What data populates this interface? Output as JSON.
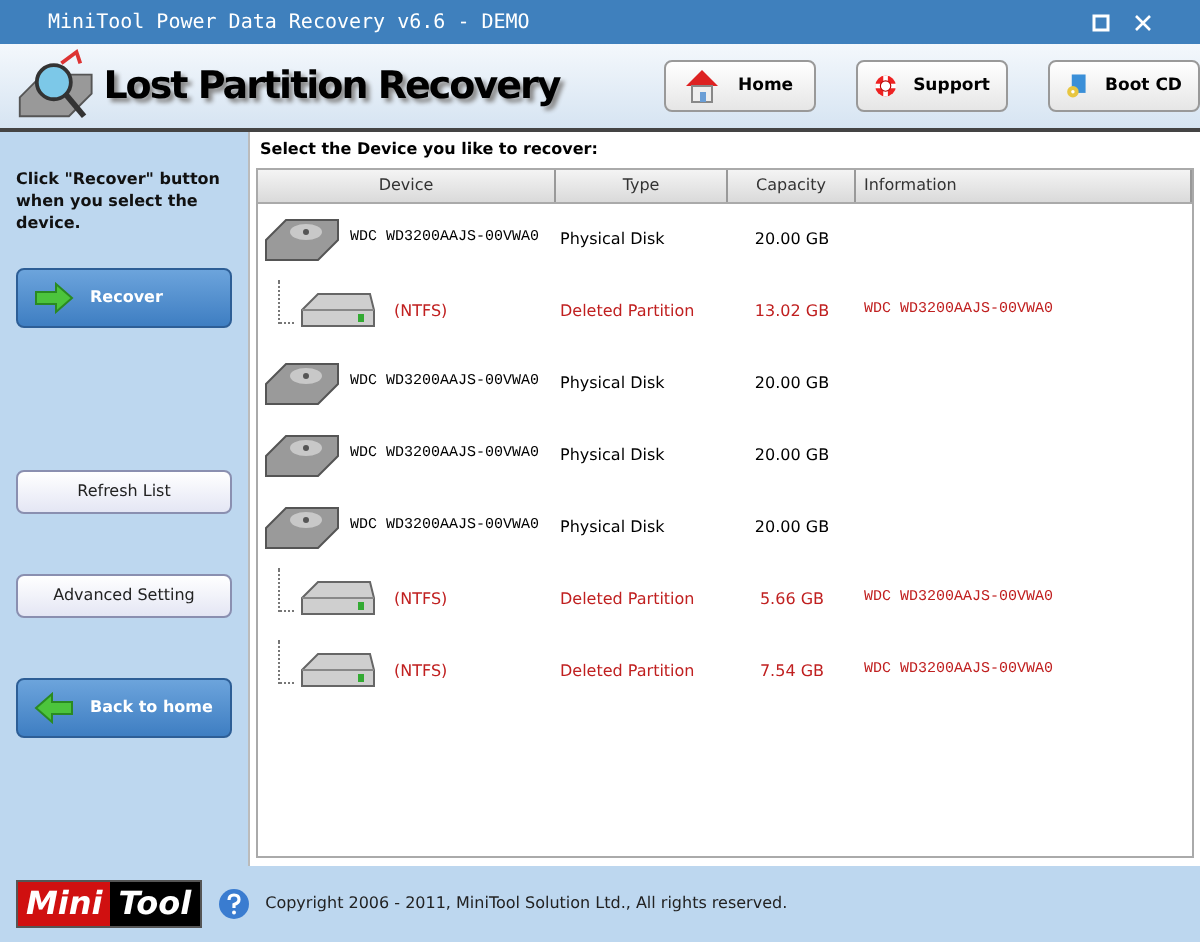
{
  "window": {
    "title": "MiniTool Power Data Recovery v6.6 - DEMO"
  },
  "header": {
    "title": "Lost Partition Recovery",
    "nav": [
      {
        "label": "Home",
        "kind": "home"
      },
      {
        "label": "Support",
        "kind": "support"
      },
      {
        "label": "Boot CD",
        "kind": "bootcd"
      }
    ]
  },
  "sidebar": {
    "hint": "Click \"Recover\" button when you select the device.",
    "buttons": [
      {
        "label": "Recover",
        "kind": "forward"
      },
      {
        "label": "Refresh List",
        "kind": "plain"
      },
      {
        "label": "Advanced Setting",
        "kind": "plain"
      },
      {
        "label": "Back to home",
        "kind": "back"
      }
    ]
  },
  "prompt": "Select the Device you like to recover:",
  "table": {
    "columns": [
      "Device",
      "Type",
      "Capacity",
      "Information"
    ],
    "rows": [
      {
        "kind": "disk",
        "device": "WDC WD3200AAJS-00VWA0",
        "type": "Physical Disk",
        "capacity": "20.00 GB"
      },
      {
        "kind": "partition",
        "device": "(NTFS)",
        "type": "Deleted Partition",
        "capacity": "13.02 GB",
        "information": "WDC WD3200AAJS-00VWA0"
      },
      {
        "kind": "disk",
        "device": "WDC WD3200AAJS-00VWA0",
        "type": "Physical Disk",
        "capacity": "20.00 GB"
      },
      {
        "kind": "disk",
        "device": "WDC WD3200AAJS-00VWA0",
        "type": "Physical Disk",
        "capacity": "20.00 GB"
      },
      {
        "kind": "disk",
        "device": "WDC WD3200AAJS-00VWA0",
        "type": "Physical Disk",
        "capacity": "20.00 GB"
      },
      {
        "kind": "partition",
        "device": "(NTFS)",
        "type": "Deleted Partition",
        "capacity": "5.66 GB",
        "information": "WDC WD3200AAJS-00VWA0"
      },
      {
        "kind": "partition",
        "device": "(NTFS)",
        "type": "Deleted Partition",
        "capacity": "7.54 GB",
        "information": "WDC WD3200AAJS-00VWA0"
      }
    ]
  },
  "footer": {
    "logo": [
      "Mini",
      "Tool"
    ],
    "copyright": "Copyright 2006 - 2011, MiniTool Solution Ltd., All rights reserved."
  }
}
